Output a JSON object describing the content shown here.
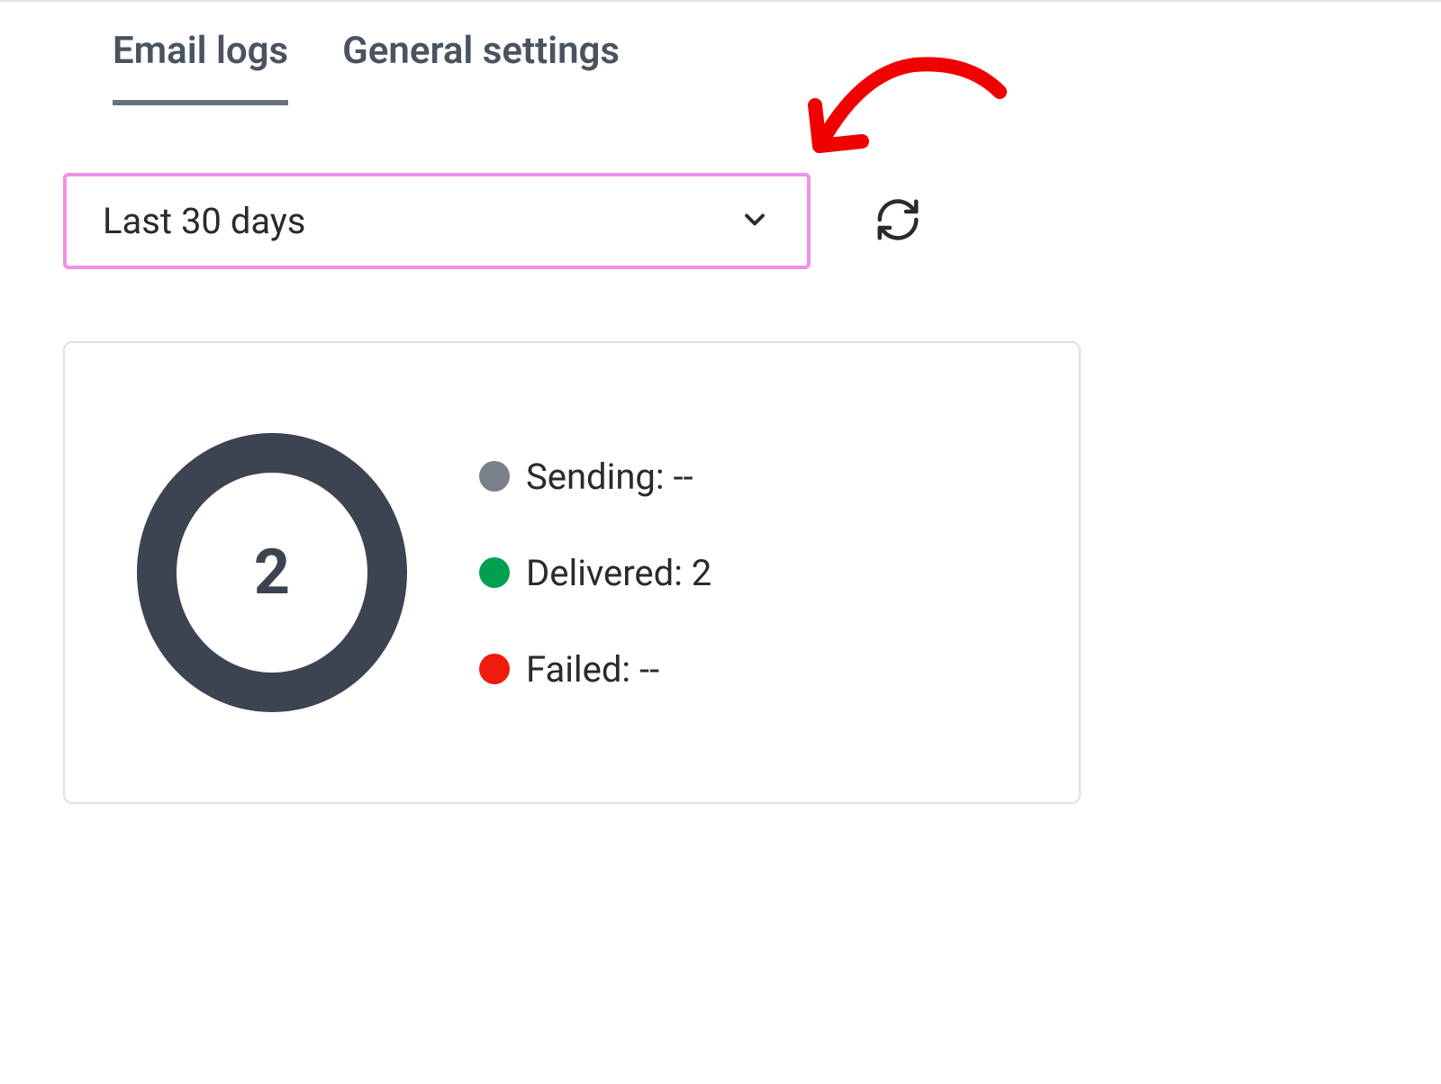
{
  "tabs": {
    "email_logs": "Email logs",
    "general_settings": "General settings"
  },
  "filter": {
    "selected": "Last 30 days"
  },
  "stats": {
    "total": "2",
    "legend": [
      {
        "label": "Sending: --",
        "color": "#7a8089"
      },
      {
        "label": "Delivered: 2",
        "color": "#00a050"
      },
      {
        "label": "Failed: --",
        "color": "#ef1c0e"
      }
    ]
  },
  "chart_data": {
    "type": "pie",
    "title": "",
    "total": 2,
    "series": [
      {
        "name": "Sending",
        "value": null,
        "color": "#7a8089"
      },
      {
        "name": "Delivered",
        "value": 2,
        "color": "#00a050"
      },
      {
        "name": "Failed",
        "value": null,
        "color": "#ef1c0e"
      }
    ]
  },
  "annotation": {
    "color": "#f00000"
  }
}
